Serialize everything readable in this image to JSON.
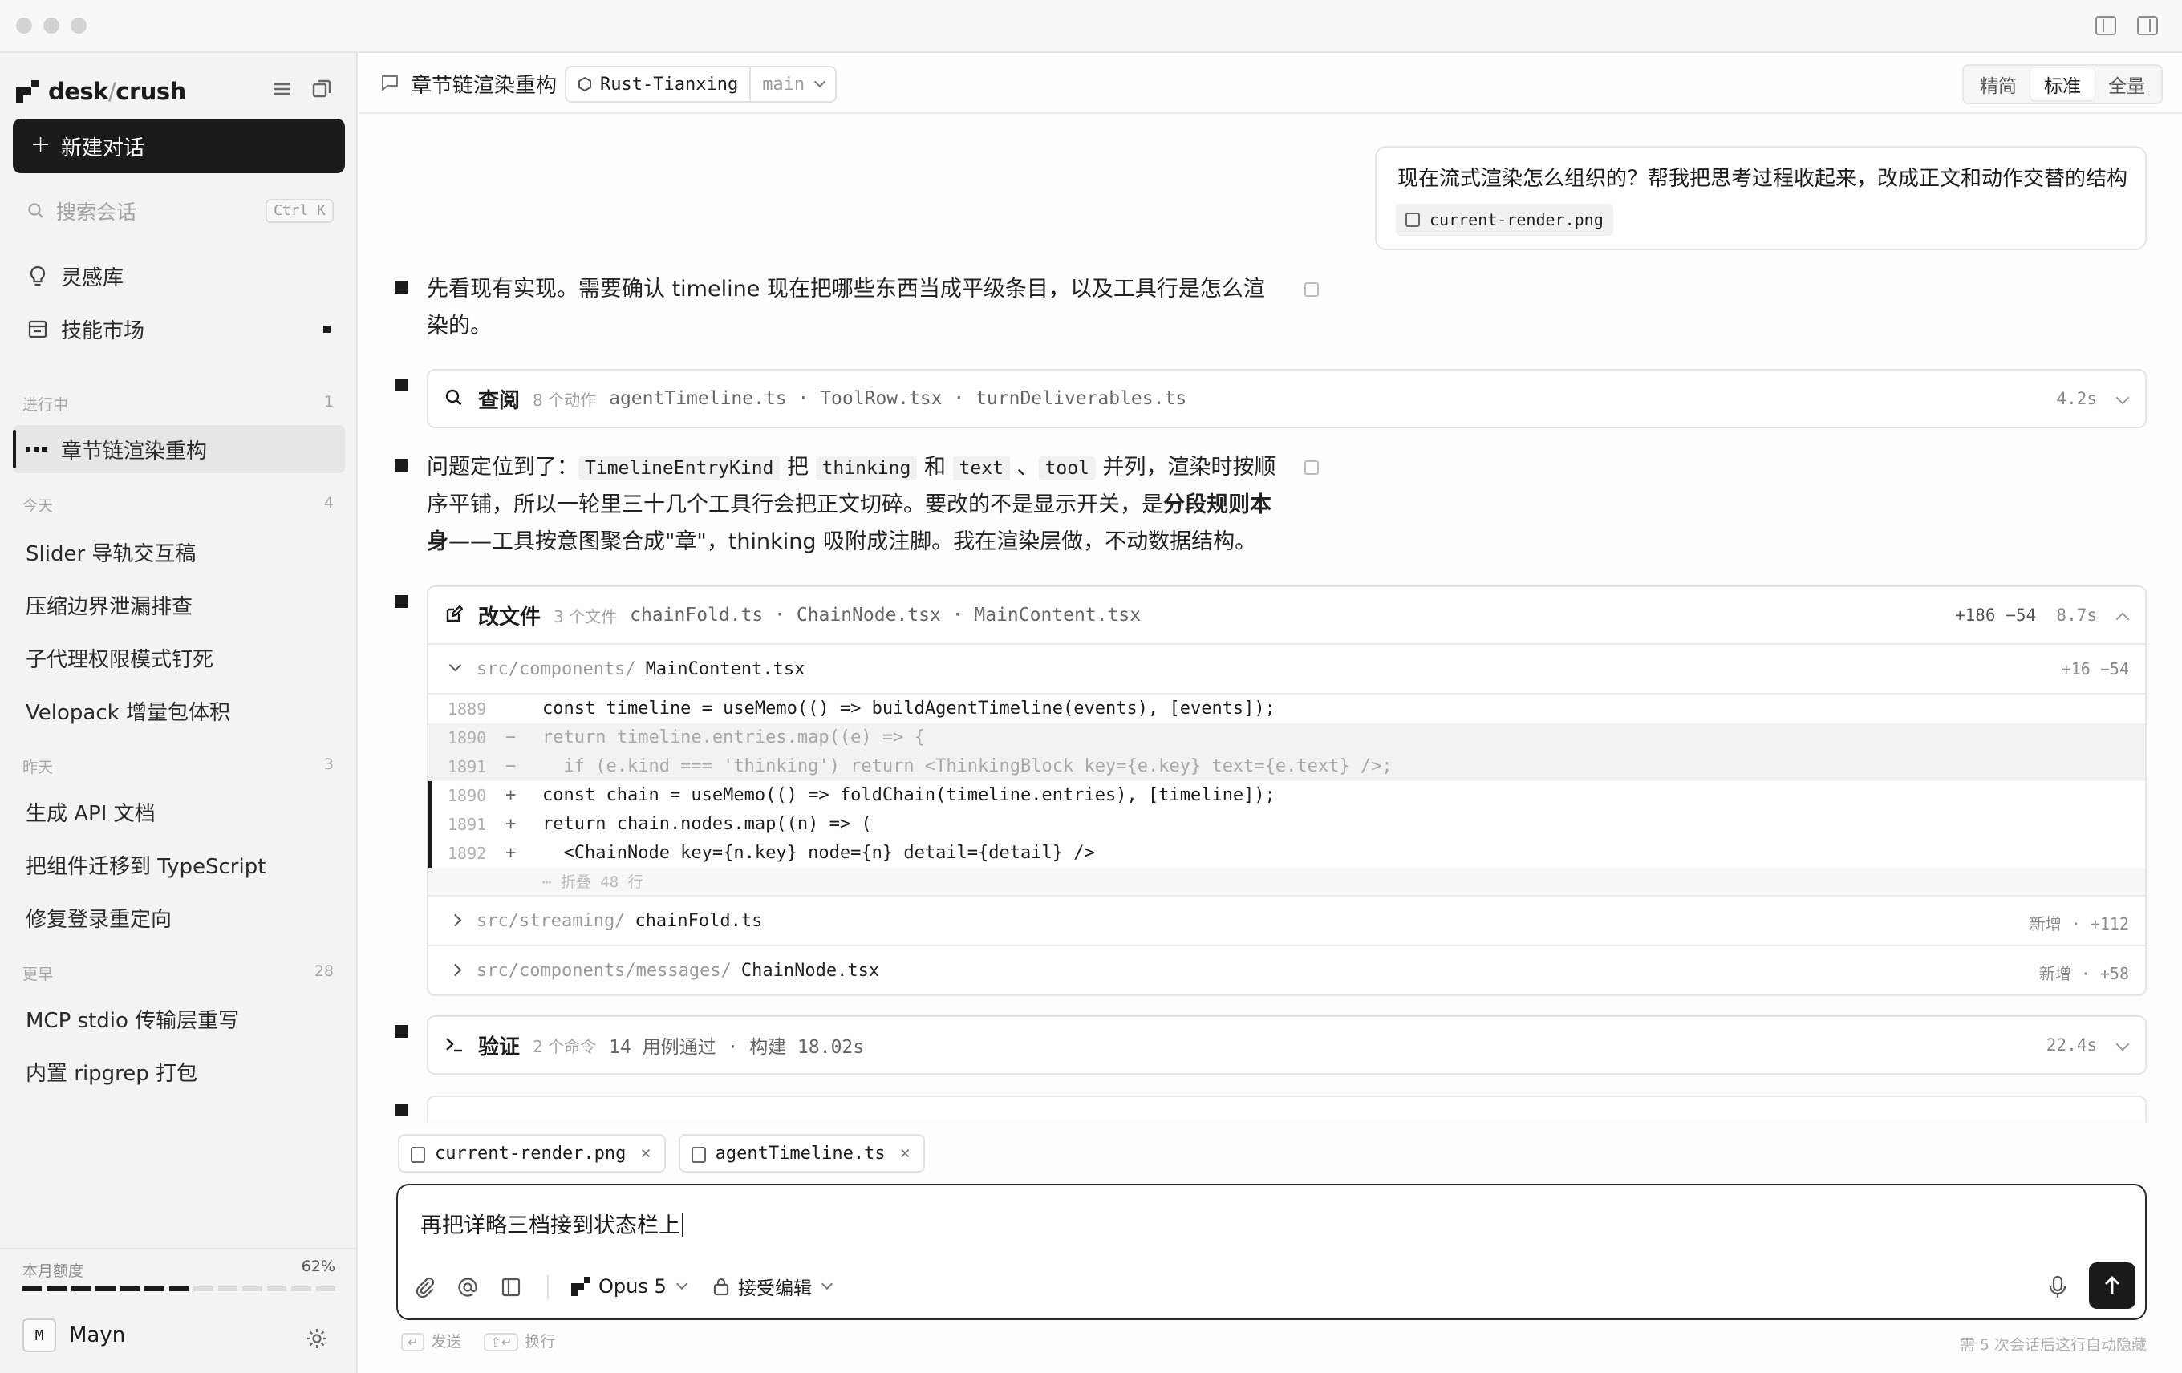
{
  "app": {
    "brand_left": "desk",
    "brand_slash": "/",
    "brand_right": "crush"
  },
  "sidebar": {
    "new_chat_label": "新建对话",
    "search_placeholder": "搜索会话",
    "search_shortcut": "Ctrl K",
    "nav": [
      {
        "label": "灵感库",
        "icon": "lightbulb-icon"
      },
      {
        "label": "技能市场",
        "icon": "store-icon"
      }
    ],
    "sections": [
      {
        "title": "进行中",
        "count": "1",
        "items": [
          "章节链渲染重构"
        ]
      },
      {
        "title": "今天",
        "count": "4",
        "items": [
          "Slider 导轨交互稿",
          "压缩边界泄漏排查",
          "子代理权限模式钉死",
          "Velopack 增量包体积"
        ]
      },
      {
        "title": "昨天",
        "count": "3",
        "items": [
          "生成 API 文档",
          "把组件迁移到 TypeScript",
          "修复登录重定向"
        ]
      },
      {
        "title": "更早",
        "count": "28",
        "items": [
          "MCP stdio 传输层重写",
          "内置 ripgrep 打包"
        ]
      }
    ],
    "quota_label": "本月额度",
    "quota_pct_text": "62%",
    "quota_fraction": 0.62,
    "user_initial": "M",
    "user_name": "Mayn"
  },
  "header": {
    "title": "章节链渲染重构",
    "repo": "Rust-Tianxing",
    "branch": "main",
    "density_options": [
      "精简",
      "标准",
      "全量"
    ],
    "density_selected": "标准"
  },
  "user_message": {
    "text": "现在流式渲染怎么组织的？帮我把思考过程收起来，改成正文和动作交替的结构",
    "attachment": "current-render.png"
  },
  "timeline": {
    "para1": "先看现有实现。需要确认 timeline 现在把哪些东西当成平级条目，以及工具行是怎么渲染的。",
    "review": {
      "title": "查阅",
      "meta": "8 个动作",
      "files": "agentTimeline.ts · ToolRow.tsx · turnDeliverables.ts",
      "duration": "4.2s"
    },
    "para2": {
      "t1": "问题定位到了：",
      "c1": "TimelineEntryKind",
      "t2": " 把 ",
      "c2": "thinking",
      "t3": " 和 ",
      "c3": "text",
      "t4": " 、",
      "c4": "tool",
      "t5": " 并列，渲染时按顺序平铺，所以一轮里三十几个工具行会把正文切碎。要改的不是显示开关，是",
      "b1": "分段规则本身",
      "t6": "——工具按意图聚合成\"章\"，thinking 吸附成注脚。我在渲染层做，不动数据结构。"
    },
    "edit": {
      "title": "改文件",
      "meta": "3 个文件",
      "files": "chainFold.ts · ChainNode.tsx · MainContent.tsx",
      "stat": "+186 −54",
      "duration": "8.7s",
      "file1": {
        "dir": "src/components/",
        "name": "MainContent.tsx",
        "stat": "+16 −54"
      },
      "diff": [
        {
          "ln": "1889",
          "sign": "",
          "code": "const timeline = useMemo(() => buildAgentTimeline(events), [events]);",
          "kind": "ctx"
        },
        {
          "ln": "1890",
          "sign": "−",
          "code": "return timeline.entries.map((e) => {",
          "kind": "del"
        },
        {
          "ln": "1891",
          "sign": "−",
          "code": "  if (e.kind === 'thinking') return <ThinkingBlock key={e.key} text={e.text} />;",
          "kind": "del"
        },
        {
          "ln": "1890",
          "sign": "+",
          "code": "const chain = useMemo(() => foldChain(timeline.entries), [timeline]);",
          "kind": "add"
        },
        {
          "ln": "1891",
          "sign": "+",
          "code": "return chain.nodes.map((n) => (",
          "kind": "add"
        },
        {
          "ln": "1892",
          "sign": "+",
          "code": "  <ChainNode key={n.key} node={n} detail={detail} />",
          "kind": "add"
        }
      ],
      "fold_text": "⋯ 折叠 48 行",
      "file2": {
        "dir": "src/streaming/",
        "name": "chainFold.ts",
        "stat": "新增 · +112"
      },
      "file3": {
        "dir": "src/components/messages/",
        "name": "ChainNode.tsx",
        "stat": "新增 · +58"
      }
    },
    "verify": {
      "title": "验证",
      "meta": "2 个命令",
      "result": "14 用例通过 · 构建 18.02s",
      "duration": "22.4s"
    }
  },
  "composer": {
    "attachments": [
      "current-render.png",
      "agentTimeline.ts"
    ],
    "input_text": "再把详略三档接到状态栏上",
    "model": "Opus 5",
    "mode": "接受编辑",
    "hint_send_key": "↵",
    "hint_send": "发送",
    "hint_newline_key": "⇧↵",
    "hint_newline": "换行",
    "autohide": "需 5 次会话后这行自动隐藏"
  }
}
